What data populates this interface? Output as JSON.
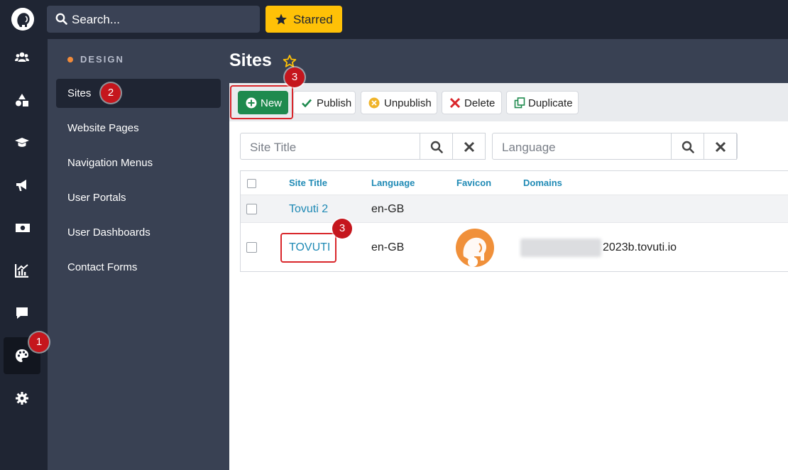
{
  "search": {
    "placeholder": "Search..."
  },
  "starred_label": "Starred",
  "section": {
    "title": "DESIGN"
  },
  "sidebar_items": [
    {
      "label": "Sites",
      "active": true
    },
    {
      "label": "Website Pages"
    },
    {
      "label": "Navigation Menus"
    },
    {
      "label": "User Portals"
    },
    {
      "label": "User Dashboards"
    },
    {
      "label": "Contact Forms"
    }
  ],
  "rail_icons": [
    "users-icon",
    "shapes-icon",
    "graduation-cap-icon",
    "megaphone-icon",
    "money-icon",
    "chart-icon",
    "comment-icon",
    "palette-icon",
    "gear-icon"
  ],
  "page": {
    "title": "Sites"
  },
  "toolbar": {
    "new": "New",
    "publish": "Publish",
    "unpublish": "Unpublish",
    "delete": "Delete",
    "duplicate": "Duplicate"
  },
  "filters": {
    "site_title_placeholder": "Site Title",
    "language_placeholder": "Language"
  },
  "table": {
    "headers": [
      "Site Title",
      "Language",
      "Favicon",
      "Domains"
    ],
    "rows": [
      {
        "title": "Tovuti 2",
        "language": "en-GB",
        "favicon": "",
        "domain": ""
      },
      {
        "title": "TOVUTI",
        "language": "en-GB",
        "favicon": "elephant-logo",
        "domain": "2023b.tovuti.io"
      }
    ]
  },
  "annotations": {
    "badge1": "1",
    "badge2": "2",
    "badge3a": "3",
    "badge3b": "3"
  },
  "colors": {
    "accent": "#1f8ab5",
    "new_button": "#1e8a4e",
    "starred": "#ffc107",
    "highlight": "#d9262b"
  }
}
